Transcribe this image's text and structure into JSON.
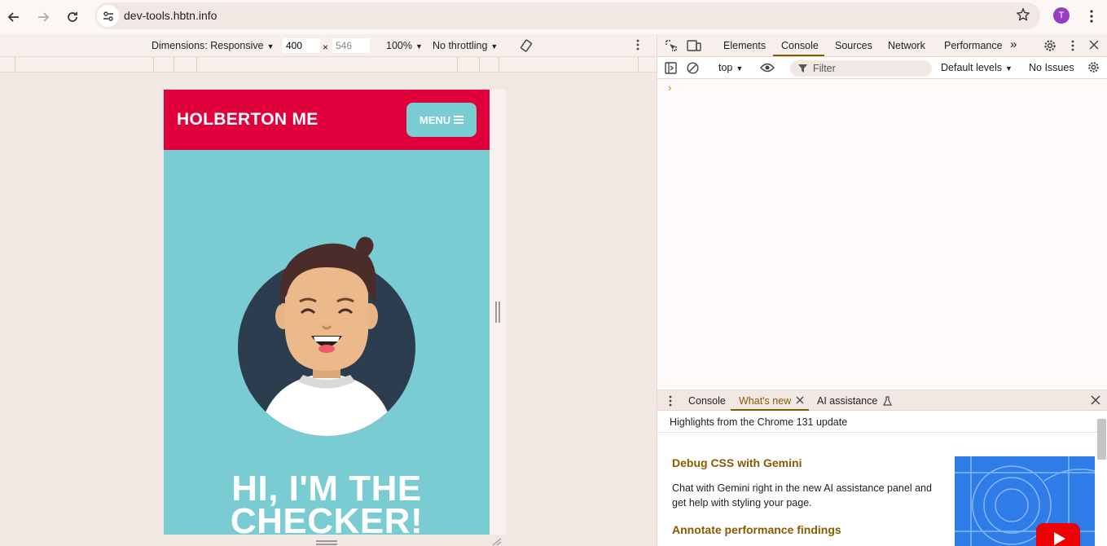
{
  "browser": {
    "url": "dev-tools.hbtn.info",
    "profile_initial": "T"
  },
  "device_toolbar": {
    "dimensions_label": "Dimensions: Responsive",
    "width": "400",
    "height": "546",
    "zoom": "100%",
    "throttling": "No throttling"
  },
  "page": {
    "logo": "HOLBERTON ME",
    "menu_label": "MENU",
    "hero_title_line1": "HI, I'M THE",
    "hero_title_line2": "CHECKER!",
    "colors": {
      "header": "#e0003c",
      "hero": "#79cdd2"
    }
  },
  "devtools": {
    "tabs": [
      "Elements",
      "Console",
      "Sources",
      "Network",
      "Performance"
    ],
    "active_tab": "Console",
    "console": {
      "context": "top",
      "filter_placeholder": "Filter",
      "levels": "Default levels",
      "issues": "No Issues",
      "prompt": "›"
    },
    "drawer": {
      "tabs": [
        "Console",
        "What's new",
        "AI assistance"
      ],
      "active_tab": "What's new",
      "highlights": "Highlights from the Chrome 131 update",
      "features": [
        {
          "title": "Debug CSS with Gemini",
          "text": "Chat with Gemini right in the new AI assistance panel and get help with styling your page."
        },
        {
          "title": "Annotate performance findings",
          "text": ""
        }
      ]
    }
  }
}
